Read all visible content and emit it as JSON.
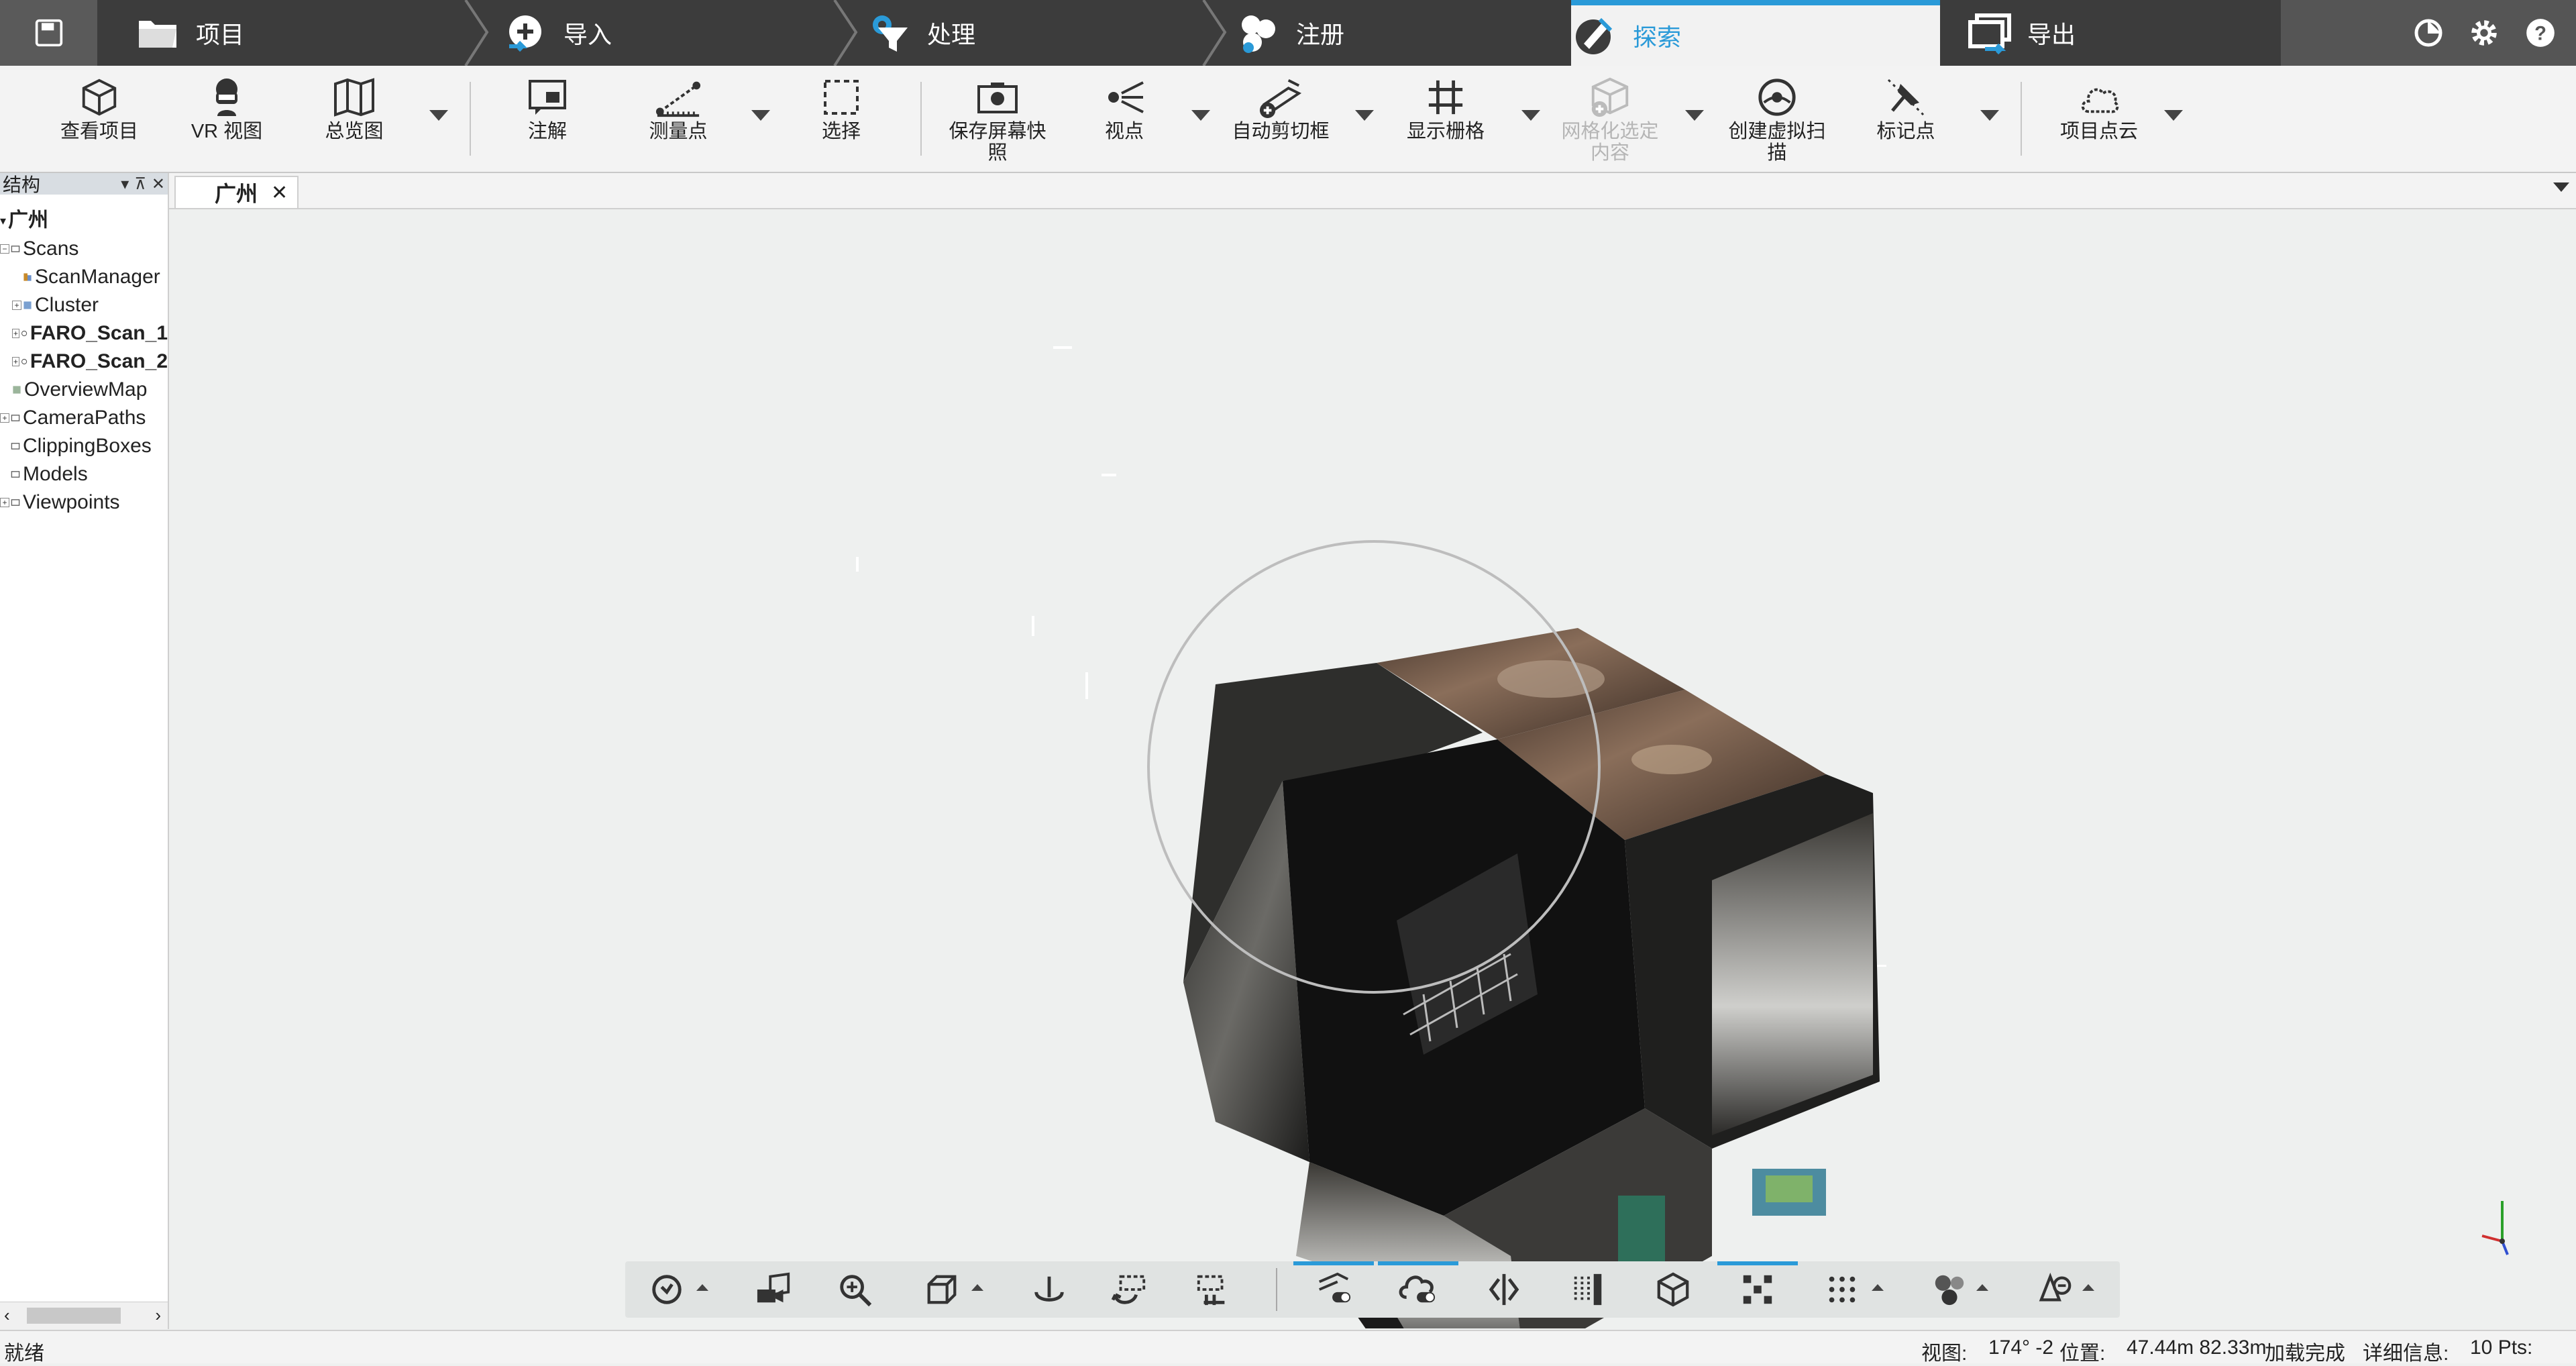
{
  "window": {
    "save_icon": "save-icon"
  },
  "tabs": [
    {
      "label": "项目",
      "icon": "folder-icon",
      "active": false
    },
    {
      "label": "导入",
      "icon": "import-icon",
      "active": false
    },
    {
      "label": "处理",
      "icon": "process-icon",
      "active": false
    },
    {
      "label": "注册",
      "icon": "register-icon",
      "active": false
    },
    {
      "label": "探索",
      "icon": "explore-icon",
      "active": true
    },
    {
      "label": "导出",
      "icon": "export-icon",
      "active": false
    }
  ],
  "top_right_icons": [
    "theme-icon",
    "gear-icon",
    "help-icon"
  ],
  "ribbon": {
    "view_project": "查看项目",
    "vr_view": "VR 视图",
    "overview": "总览图",
    "annotation": "注解",
    "measure_point": "测量点",
    "select": "选择",
    "save_screenshot_1": "保存屏幕快",
    "save_screenshot_2": "照",
    "viewpoint": "视点",
    "auto_clipbox": "自动剪切框",
    "show_grid": "显示栅格",
    "mesh_selection_1": "网格化选定",
    "mesh_selection_2": "内容",
    "create_virtual_scan_1": "创建虚拟扫",
    "create_virtual_scan_2": "描",
    "markers": "标记点",
    "project_point_cloud": "项目点云"
  },
  "structure_panel": {
    "title": "结构",
    "tree": [
      {
        "label": "广州",
        "bold": true,
        "indent": 0,
        "expander": ""
      },
      {
        "label": "Scans",
        "bold": false,
        "indent": 0,
        "expander": "−"
      },
      {
        "label": "ScanManager",
        "bold": false,
        "indent": 2,
        "expander": ""
      },
      {
        "label": "Cluster",
        "bold": false,
        "indent": 1,
        "expander": "+"
      },
      {
        "label": "FARO_Scan_1",
        "bold": true,
        "indent": 1,
        "expander": "+"
      },
      {
        "label": "FARO_Scan_2",
        "bold": true,
        "indent": 1,
        "expander": "+"
      },
      {
        "label": "OverviewMap",
        "bold": false,
        "indent": 0,
        "expander": ""
      },
      {
        "label": "CameraPaths",
        "bold": false,
        "indent": 0,
        "expander": "+"
      },
      {
        "label": "ClippingBoxes",
        "bold": false,
        "indent": 0,
        "expander": ""
      },
      {
        "label": "Models",
        "bold": false,
        "indent": 0,
        "expander": ""
      },
      {
        "label": "Viewpoints",
        "bold": false,
        "indent": 0,
        "expander": "+"
      }
    ]
  },
  "document": {
    "tab_label": "广州"
  },
  "status": {
    "ready": "就绪",
    "view_label": "视图:",
    "view_value": "174° -2",
    "position_label": "位置:",
    "position_value": "47.44m 82.33m",
    "load_done": "加载完成",
    "detail_label": "详细信息:",
    "detail_value": "10 Pts:"
  },
  "colors": {
    "accent": "#2a9ad8",
    "topbar": "#3c3c3c"
  }
}
